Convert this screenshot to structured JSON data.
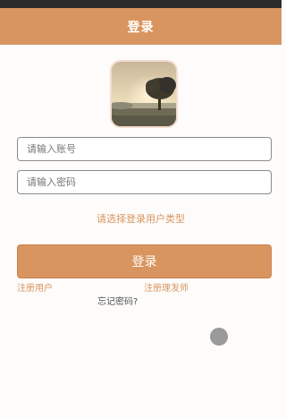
{
  "header": {
    "title": "登录"
  },
  "avatar": {
    "icon": "landscape-tree-icon"
  },
  "form": {
    "account_placeholder": "请输入账号",
    "password_placeholder": "请输入密码",
    "user_type_label": "请选择登录用户类型",
    "login_label": "登录"
  },
  "links": {
    "register_user": "注册用户",
    "register_barber": "注册理发师",
    "forgot_password": "忘记密码?"
  },
  "colors": {
    "accent": "#d9955f",
    "background": "#fdfcfb",
    "float_button": "#9a9a9a"
  }
}
